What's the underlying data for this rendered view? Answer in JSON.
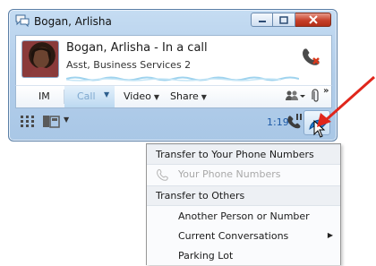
{
  "window": {
    "title": "Bogan, Arlisha",
    "title_icon": "conversation-icon"
  },
  "contact": {
    "name_status": "Bogan, Arlisha - In a call",
    "job_title": "Asst, Business Services 2",
    "hangup_icon": "hang-up-icon"
  },
  "tabs": {
    "im": "IM",
    "call": "Call",
    "video": "Video",
    "share": "Share",
    "more": "»"
  },
  "controls": {
    "duration": "1:19"
  },
  "menu": {
    "header_phone": "Transfer to Your Phone Numbers",
    "your_phone_numbers": "Your Phone Numbers",
    "header_others": "Transfer to Others",
    "another_person": "Another Person or Number",
    "current_conversations": "Current Conversations",
    "parking_lot": "Parking Lot"
  },
  "colors": {
    "frame": "#b4cfeb",
    "accent_blue": "#1e5aa6",
    "annotation_red": "#e0261b"
  }
}
